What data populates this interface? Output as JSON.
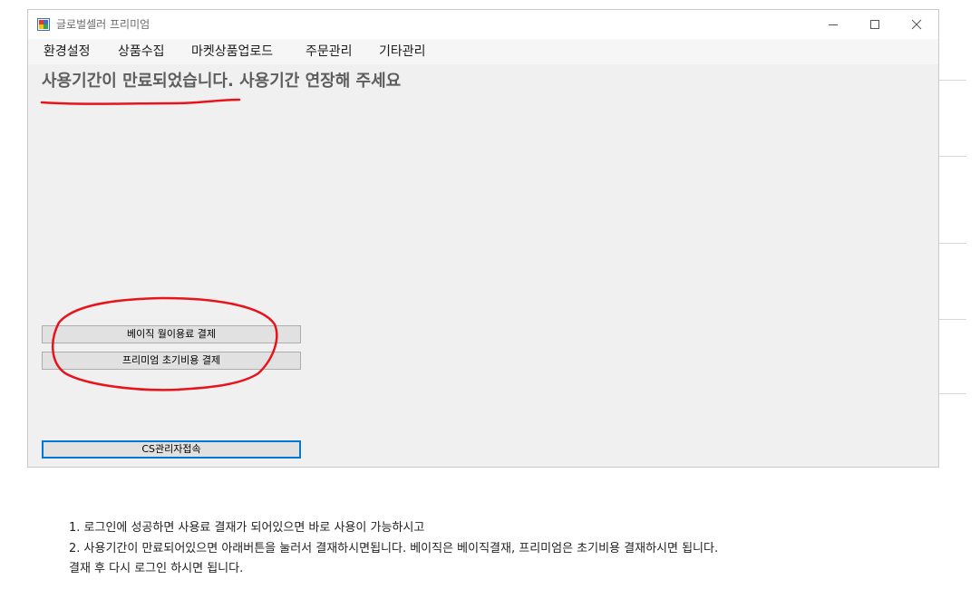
{
  "window": {
    "title": "글로벌셀러 프리미엄",
    "icon": "app-window-icon"
  },
  "menu": {
    "items": [
      {
        "label": "환경설정"
      },
      {
        "label": "상품수집"
      },
      {
        "label": "마켓상품업로드"
      },
      {
        "label": "주문관리"
      },
      {
        "label": "기타관리"
      }
    ]
  },
  "main": {
    "expired_message": "사용기간이 만료되었습니다. 사용기간 연장해 주세요",
    "basic_payment_button": "베이직 월이용료 결제",
    "premium_payment_button": "프리미엄 초기비용 결제",
    "cs_admin_button": "CS관리자접속"
  },
  "instructions": {
    "line1": "1. 로그인에 성공하면 사용료 결재가 되어있으면 바로 사용이 가능하시고",
    "line2": "2. 사용기간이 만료되어있으면 아래버튼을 눌러서 결재하시면됩니다. 베이직은 베이직결재, 프리미엄은 초기비용 결재하시면 됩니다.",
    "line3": "결재 후 다시 로그인 하시면 됩니다."
  },
  "colors": {
    "annotation": "#e8131b",
    "focus_border": "#0078d7",
    "window_bg": "#f0f0f0"
  }
}
